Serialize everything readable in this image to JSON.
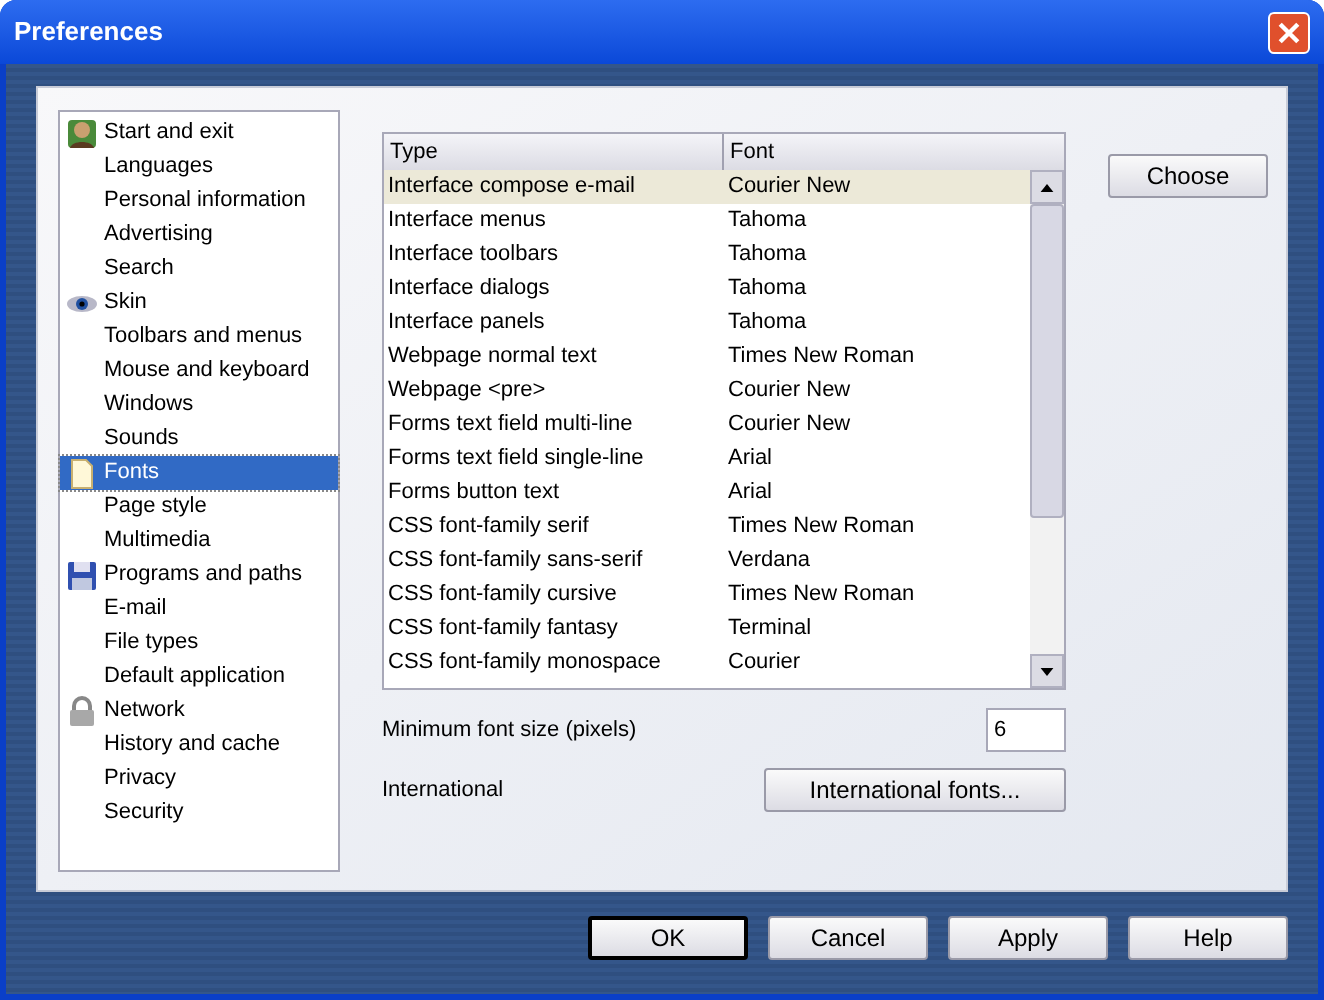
{
  "window": {
    "title": "Preferences"
  },
  "sidebar": {
    "items": [
      {
        "label": "Start and exit",
        "kind": "icon",
        "selected": false
      },
      {
        "label": "Languages",
        "kind": "plain",
        "selected": false
      },
      {
        "label": "Personal information",
        "kind": "plain",
        "selected": false
      },
      {
        "label": "Advertising",
        "kind": "plain",
        "selected": false
      },
      {
        "label": "Search",
        "kind": "plain",
        "selected": false
      },
      {
        "label": "Skin",
        "kind": "icon",
        "selected": false
      },
      {
        "label": "Toolbars and menus",
        "kind": "plain",
        "selected": false
      },
      {
        "label": "Mouse and keyboard",
        "kind": "plain",
        "selected": false
      },
      {
        "label": "Windows",
        "kind": "plain",
        "selected": false
      },
      {
        "label": "Sounds",
        "kind": "plain",
        "selected": false
      },
      {
        "label": "Fonts",
        "kind": "icon",
        "selected": true
      },
      {
        "label": "Page style",
        "kind": "plain",
        "selected": false
      },
      {
        "label": "Multimedia",
        "kind": "plain",
        "selected": false
      },
      {
        "label": "Programs and paths",
        "kind": "icon",
        "selected": false
      },
      {
        "label": "E-mail",
        "kind": "plain",
        "selected": false
      },
      {
        "label": "File types",
        "kind": "plain",
        "selected": false
      },
      {
        "label": "Default application",
        "kind": "plain",
        "selected": false
      },
      {
        "label": "Network",
        "kind": "icon",
        "selected": false
      },
      {
        "label": "History and cache",
        "kind": "plain",
        "selected": false
      },
      {
        "label": "Privacy",
        "kind": "plain",
        "selected": false
      },
      {
        "label": "Security",
        "kind": "plain",
        "selected": false
      }
    ]
  },
  "table": {
    "columns": [
      "Type",
      "Font"
    ],
    "rows": [
      {
        "type": "Interface compose e-mail",
        "font": "Courier New",
        "selected": true
      },
      {
        "type": "Interface menus",
        "font": "Tahoma",
        "selected": false
      },
      {
        "type": "Interface toolbars",
        "font": "Tahoma",
        "selected": false
      },
      {
        "type": "Interface dialogs",
        "font": "Tahoma",
        "selected": false
      },
      {
        "type": "Interface panels",
        "font": "Tahoma",
        "selected": false
      },
      {
        "type": "Webpage normal text",
        "font": "Times New Roman",
        "selected": false
      },
      {
        "type": "Webpage <pre>",
        "font": "Courier New",
        "selected": false
      },
      {
        "type": "Forms text field multi-line",
        "font": "Courier New",
        "selected": false
      },
      {
        "type": "Forms text field single-line",
        "font": "Arial",
        "selected": false
      },
      {
        "type": "Forms button text",
        "font": "Arial",
        "selected": false
      },
      {
        "type": "CSS font-family serif",
        "font": "Times New Roman",
        "selected": false
      },
      {
        "type": "CSS font-family sans-serif",
        "font": "Verdana",
        "selected": false
      },
      {
        "type": "CSS font-family cursive",
        "font": "Times New Roman",
        "selected": false
      },
      {
        "type": "CSS font-family fantasy",
        "font": "Terminal",
        "selected": false
      },
      {
        "type": "CSS font-family monospace",
        "font": "Courier",
        "selected": false
      }
    ]
  },
  "choose_button": "Choose",
  "minimum_font_size": {
    "label": "Minimum font size (pixels)",
    "value": "6"
  },
  "international": {
    "label": "International",
    "button": "International fonts..."
  },
  "buttons": [
    {
      "label": "OK",
      "default": true
    },
    {
      "label": "Cancel",
      "default": false
    },
    {
      "label": "Apply",
      "default": false
    },
    {
      "label": "Help",
      "default": false
    }
  ]
}
